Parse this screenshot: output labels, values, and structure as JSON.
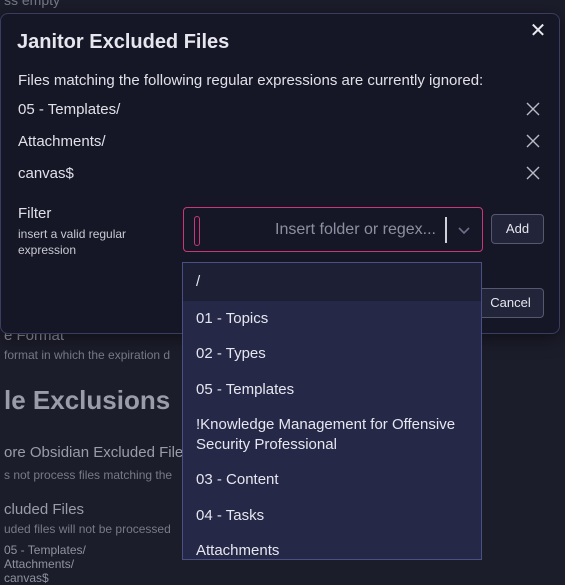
{
  "background": {
    "top_text": "ss empty",
    "date_format_label": "e Format",
    "date_format_desc": "format in which the expiration d",
    "section_heading": "le Exclusions",
    "ignore_label": "ore Obsidian Excluded File",
    "ignore_desc": "s not process files matching the",
    "excluded_label": "cluded Files",
    "excluded_desc": "uded files will not be processed",
    "excluded_list": [
      "05 - Templates/",
      "Attachments/",
      "canvas$"
    ]
  },
  "modal": {
    "title": "Janitor Excluded Files",
    "description": "Files matching the following regular expressions are currently ignored:",
    "entries": [
      "05 - Templates/",
      "Attachments/",
      "canvas$"
    ],
    "filter_label": "Filter",
    "filter_description": "insert a valid regular expression",
    "filter_placeholder": "Insert folder or regex...",
    "add_button": "Add",
    "cancel_button": "Cancel",
    "close_symbol": "✕"
  },
  "dropdown": {
    "options": [
      "/",
      "01 - Topics",
      "02 - Types",
      "05 - Templates",
      "!Knowledge Management for Offensive Security Professional",
      "03 - Content",
      "04 - Tasks",
      "Attachments"
    ],
    "active_index": 0
  },
  "colors": {
    "accent_focus": "#c7377a",
    "menu_bg": "#252947",
    "modal_bg": "#161726"
  }
}
